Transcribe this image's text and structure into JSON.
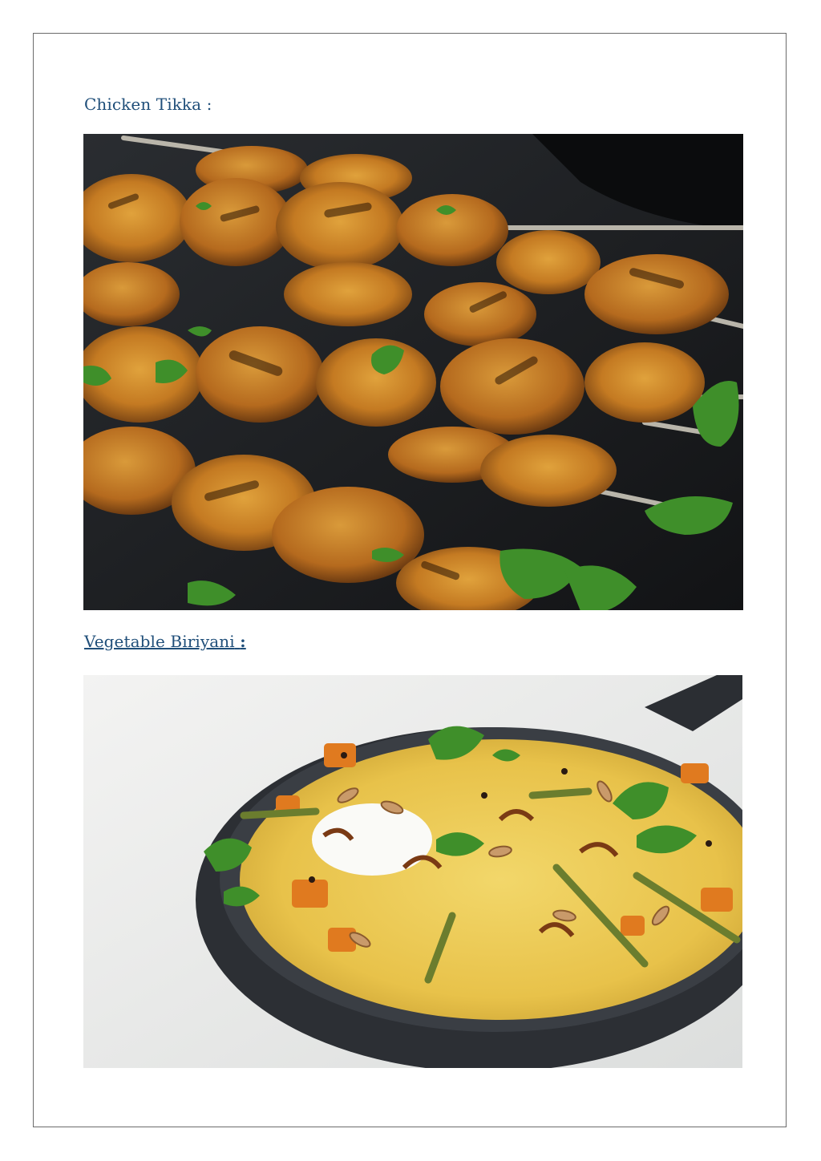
{
  "sections": [
    {
      "title": "Chicken Tikka :",
      "image_alt": "Grilled chicken tikka skewers garnished with coriander on dark slate"
    },
    {
      "title": "Vegetable Biriyani",
      "title_suffix": ":",
      "image_alt": "Vegetable biriyani in a cast iron skillet topped with yogurt, almonds, fried onions and coriander"
    }
  ],
  "colors": {
    "heading": "#1f4e79",
    "border": "#6b6b6b"
  }
}
